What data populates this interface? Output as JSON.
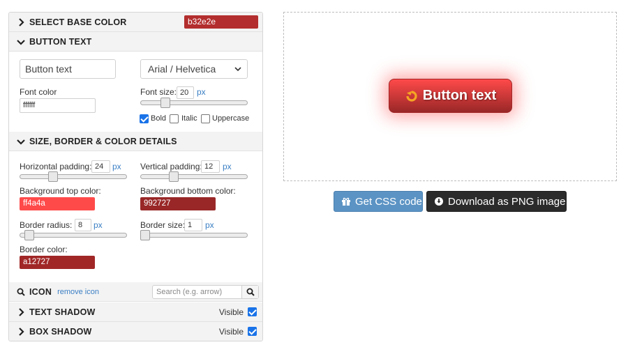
{
  "base_color": {
    "title": "SELECT BASE COLOR",
    "value": "b32e2e",
    "swatch_color": "#b32e2e"
  },
  "button_text": {
    "title": "BUTTON TEXT",
    "text_value": "Button text",
    "font_value": "Arial / Helvetica",
    "font_color_label": "Font color",
    "font_color_value": "ffffff",
    "font_size_label": "Font size:",
    "font_size_value": "20",
    "font_size_unit": "px",
    "font_size_slider_level": 0.2,
    "bold_label": "Bold",
    "bold_checked": true,
    "italic_label": "Italic",
    "italic_checked": false,
    "uppercase_label": "Uppercase",
    "uppercase_checked": false
  },
  "details": {
    "title": "SIZE, BORDER & COLOR DETAILS",
    "h_padding_label": "Horizontal padding:",
    "h_padding_value": "24",
    "h_padding_unit": "px",
    "v_padding_label": "Vertical padding:",
    "v_padding_value": "12",
    "v_padding_unit": "px",
    "bg_top_label": "Background top color:",
    "bg_top_value": "ff4a4a",
    "bg_top_color": "#ff4a4a",
    "bg_bottom_label": "Background bottom color:",
    "bg_bottom_value": "992727",
    "bg_bottom_color": "#992727",
    "radius_label": "Border radius:",
    "radius_value": "8",
    "radius_unit": "px",
    "border_size_label": "Border size:",
    "border_size_value": "1",
    "border_size_unit": "px",
    "border_color_label": "Border color:",
    "border_color_value": "a12727",
    "border_color": "#a12727"
  },
  "icon": {
    "title": "ICON",
    "remove_link": "remove icon",
    "search_placeholder": "Search (e.g. arrow)"
  },
  "text_shadow": {
    "title": "TEXT SHADOW",
    "visible_label": "Visible",
    "visible_checked": true
  },
  "box_shadow": {
    "title": "BOX SHADOW",
    "visible_label": "Visible",
    "visible_checked": true
  },
  "preview": {
    "button_label": "Button text",
    "icon": "rotate-arrow-icon"
  },
  "actions": {
    "css_label": "Get CSS code",
    "css_color": "#5b93c4",
    "png_label": "Download as PNG image",
    "png_color": "#2b2b2b"
  }
}
